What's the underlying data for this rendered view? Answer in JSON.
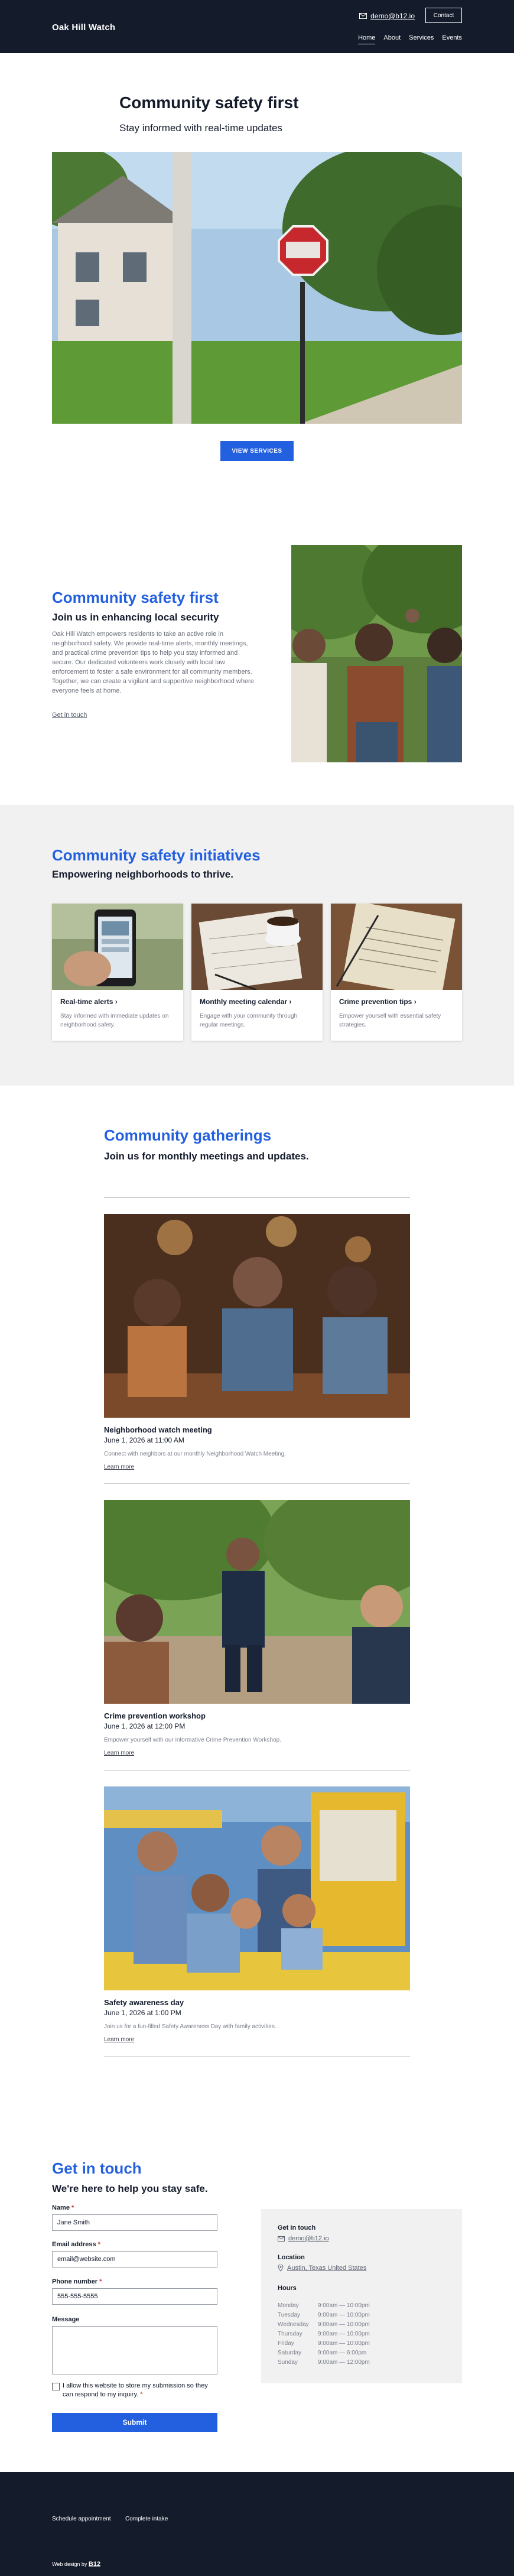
{
  "header": {
    "brand": "Oak Hill Watch",
    "email": "demo@b12.io",
    "contact_label": "Contact",
    "nav": [
      {
        "label": "Home",
        "active": true
      },
      {
        "label": "About",
        "active": false
      },
      {
        "label": "Services",
        "active": false
      },
      {
        "label": "Events",
        "active": false
      }
    ]
  },
  "hero": {
    "title": "Community safety first",
    "subtitle": "Stay informed with real-time updates",
    "image": "neighborhood-stop-sign-photo",
    "button_label": "VIEW SERVICES"
  },
  "about": {
    "title": "Community safety first",
    "subtitle": "Join us in enhancing local security",
    "body": "Oak Hill Watch empowers residents to take an active role in neighborhood safety. We provide real-time alerts, monthly meetings, and practical crime prevention tips to help you stay informed and secure. Our dedicated volunteers work closely with local law enforcement to foster a safe environment for all community members. Together, we can create a vigilant and supportive neighborhood where everyone feels at home.",
    "link": "Get in touch",
    "image": "community-meeting-park-photo"
  },
  "initiatives": {
    "title": "Community safety initiatives",
    "subtitle": "Empowering neighborhoods to thrive.",
    "cards": [
      {
        "title": "Real-time alerts",
        "desc": "Stay informed with immediate updates on neighborhood safety.",
        "image": "phone-alert-photo"
      },
      {
        "title": "Monthly meeting calendar",
        "desc": "Engage with your community through regular meetings.",
        "image": "calendar-coffee-photo"
      },
      {
        "title": "Crime prevention tips",
        "desc": "Empower yourself with essential safety strategies.",
        "image": "notebook-photo"
      }
    ]
  },
  "events": {
    "title": "Community gatherings",
    "subtitle": "Join us for monthly meetings and updates.",
    "items": [
      {
        "title": "Neighborhood watch meeting",
        "date": "June 1, 2026 at 11:00 AM",
        "desc": "Connect with neighbors at our monthly Neighborhood Watch Meeting.",
        "link": "Learn more",
        "image": "group-table-photo"
      },
      {
        "title": "Crime prevention workshop",
        "date": "June 1, 2026 at 12:00 PM",
        "desc": "Empower yourself with our informative Crime Prevention Workshop.",
        "link": "Learn more",
        "image": "police-officer-park-photo"
      },
      {
        "title": "Safety awareness day",
        "date": "June 1, 2026 at 1:00 PM",
        "desc": "Join us for a fun-filled Safety Awareness Day with family activities.",
        "link": "Learn more",
        "image": "families-fair-photo"
      }
    ]
  },
  "contact": {
    "title": "Get in touch",
    "subtitle": "We're here to help you stay safe.",
    "fields": {
      "name_label": "Name",
      "name_value": "Jane Smith",
      "email_label": "Email address",
      "email_value": "email@website.com",
      "phone_label": "Phone number",
      "phone_value": "555-555-5555",
      "message_label": "Message"
    },
    "consent": "I allow this website to store my submission so they can respond to my inquiry.",
    "submit": "Submit",
    "info": {
      "heading": "Get in touch",
      "email": "demo@b12.io",
      "location_heading": "Location",
      "location": "Austin, Texas United States",
      "hours_heading": "Hours",
      "hours": [
        {
          "day": "Monday",
          "time": "9:00am — 10:00pm"
        },
        {
          "day": "Tuesday",
          "time": "9:00am — 10:00pm"
        },
        {
          "day": "Wednesday",
          "time": "9:00am — 10:00pm"
        },
        {
          "day": "Thursday",
          "time": "9:00am — 10:00pm"
        },
        {
          "day": "Friday",
          "time": "9:00am — 10:00pm"
        },
        {
          "day": "Saturday",
          "time": "9:00am — 6:00pm"
        },
        {
          "day": "Sunday",
          "time": "9:00am — 12:00pm"
        }
      ]
    }
  },
  "footer": {
    "links": [
      "Schedule appointment",
      "Complete intake"
    ],
    "design_prefix": "Web design by",
    "design_brand": "B12"
  },
  "colors": {
    "accent": "#2360e0",
    "dark": "#141b2b",
    "panel": "#f1f1f1"
  }
}
